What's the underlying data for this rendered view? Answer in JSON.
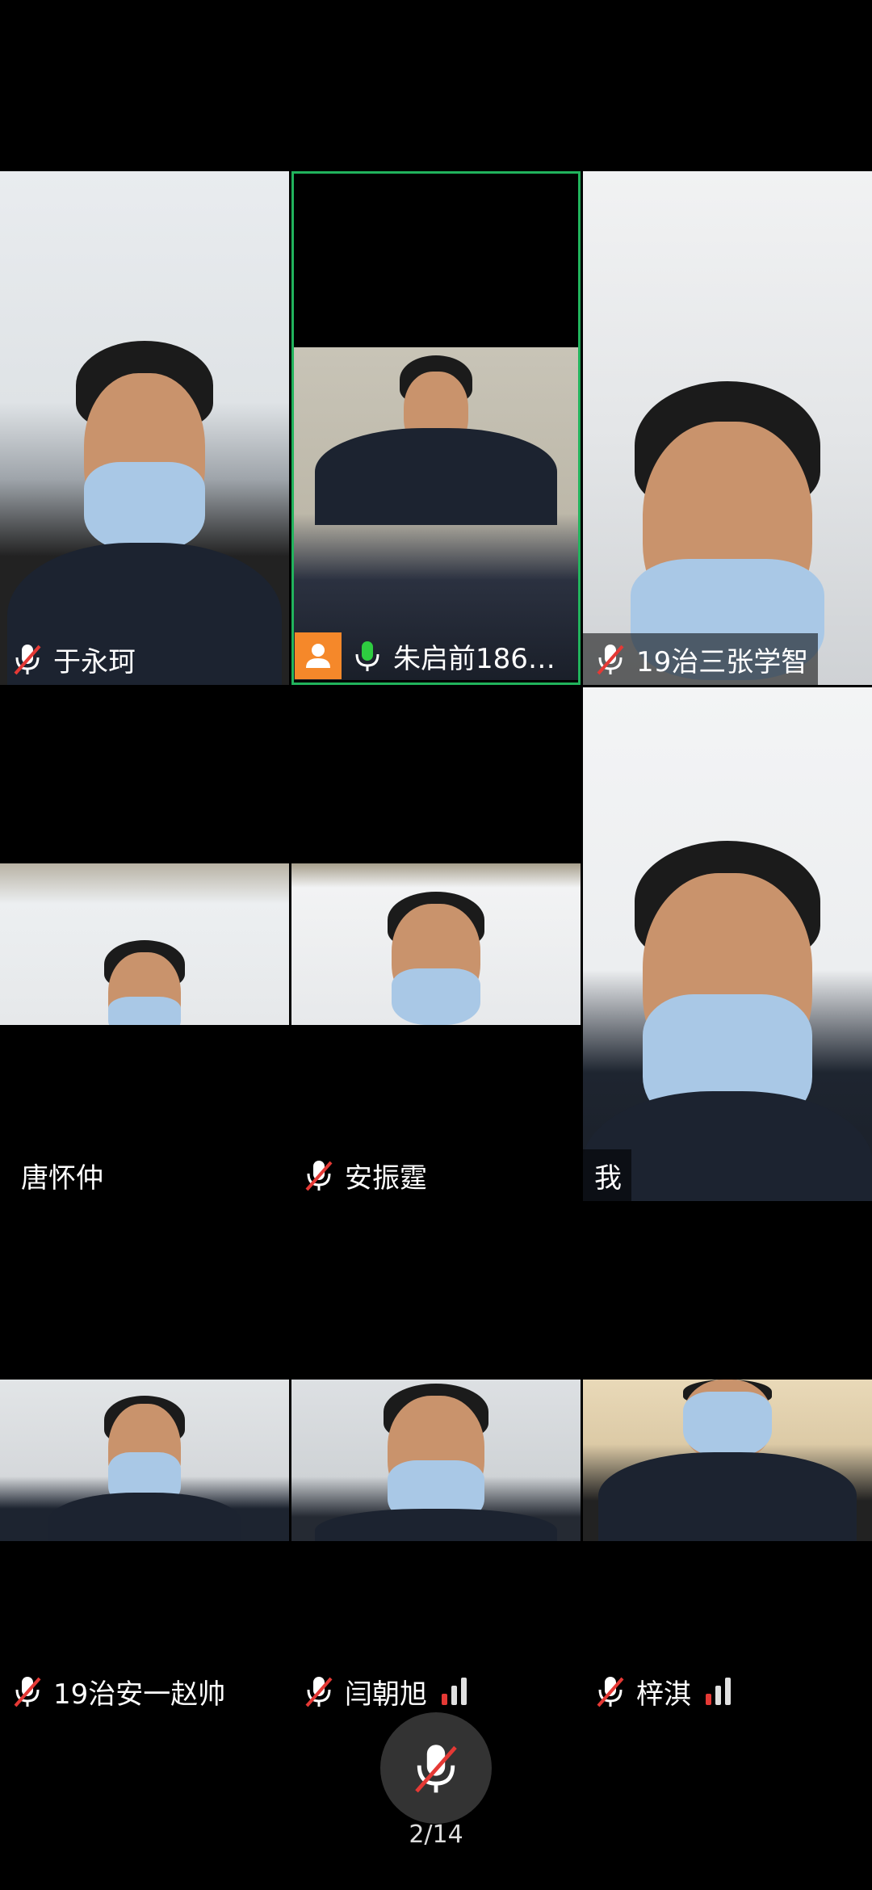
{
  "participants": [
    {
      "name": "于永珂",
      "muted": true
    },
    {
      "name": "朱启前186…",
      "muted": false,
      "speaking": true
    },
    {
      "name": "19治三张学智",
      "muted": true
    },
    {
      "name": "唐怀仲",
      "muted": false
    },
    {
      "name": "安振霆",
      "muted": true
    },
    {
      "name": "我",
      "muted": false
    },
    {
      "name": "19治安一赵帅",
      "muted": true
    },
    {
      "name": "闫朝旭",
      "muted": true,
      "signal": "weak"
    },
    {
      "name": "梓淇",
      "muted": true,
      "signal": "weak"
    }
  ],
  "controls": {
    "mute_icon": "mic-muted-icon"
  },
  "pager": {
    "text": "2/14"
  },
  "colors": {
    "active_border": "#21b35c",
    "mic_on": "#2ecc40",
    "mic_off_slash": "#e53935",
    "avatar_badge": "#f5882a"
  }
}
